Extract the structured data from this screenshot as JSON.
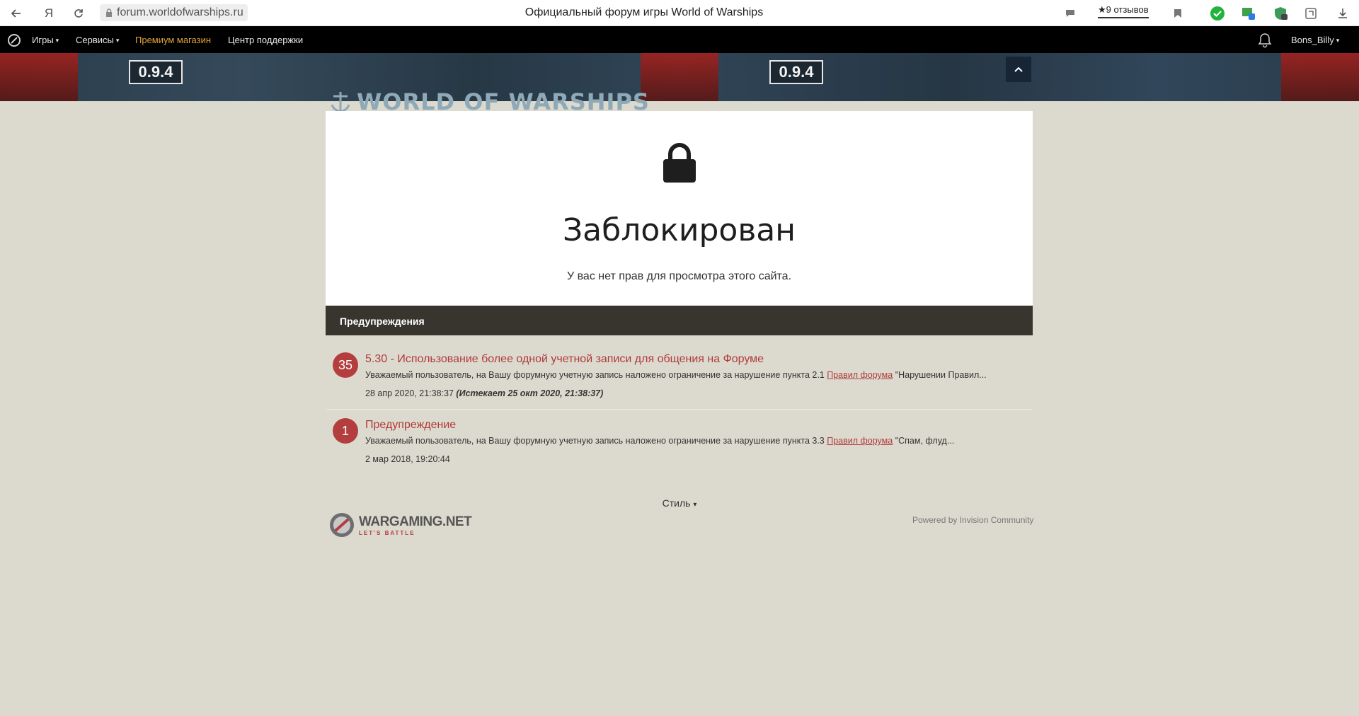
{
  "browser": {
    "url": "forum.worldofwarships.ru",
    "tab_title": "Официальный форум игры World of Warships",
    "yandex_label": "Я",
    "reviews": "★9 отзывов"
  },
  "nav": {
    "games": "Игры",
    "services": "Сервисы",
    "premium": "Премиум магазин",
    "support": "Центр поддержки",
    "username": "Bons_Billy"
  },
  "banner": {
    "version": "0.9.4",
    "logo_text": "WORLD OF WARSHIPS"
  },
  "blocked": {
    "title": "Заблокирован",
    "subtitle": "У вас нет прав для просмотра этого сайта."
  },
  "warnings": {
    "header": "Предупреждения",
    "items": [
      {
        "points": "35",
        "title": "5.30 - Использование более одной учетной записи для общения на Форуме",
        "text_before": "Уважаемый пользователь, на Вашу форумную учетную запись наложено ограничение за нарушение пункта 2.1 ",
        "link": "Правил форума",
        "text_after": " \"Нарушении Правил...",
        "date": "28 апр 2020, 21:38:37",
        "expires": "(Истекает 25 окт 2020, 21:38:37)"
      },
      {
        "points": "1",
        "title": "Предупреждение",
        "text_before": "Уважаемый пользователь, на Вашу форумную учетную запись наложено ограничение за нарушение пункта 3.3 ",
        "link": "Правил форума",
        "text_after": " \"Спам, флуд...",
        "date": "2 мар 2018, 19:20:44"
      }
    ]
  },
  "footer": {
    "style": "Стиль",
    "wg_name": "WARGAMING.NET",
    "wg_tagline": "LET'S BATTLE",
    "powered": "Powered by Invision Community"
  },
  "colors": {
    "accent_red": "#b03a3a",
    "premium_gold": "#e1a33c",
    "page_bg": "#dcdace",
    "header_dark": "#37352d"
  },
  "icons": [
    "back-icon",
    "yandex-icon",
    "reload-icon",
    "lock-icon",
    "comment-icon",
    "bookmark-icon",
    "check-icon",
    "extension-icon",
    "download-icon",
    "bell-icon",
    "chevron-up-icon",
    "padlock-icon"
  ]
}
